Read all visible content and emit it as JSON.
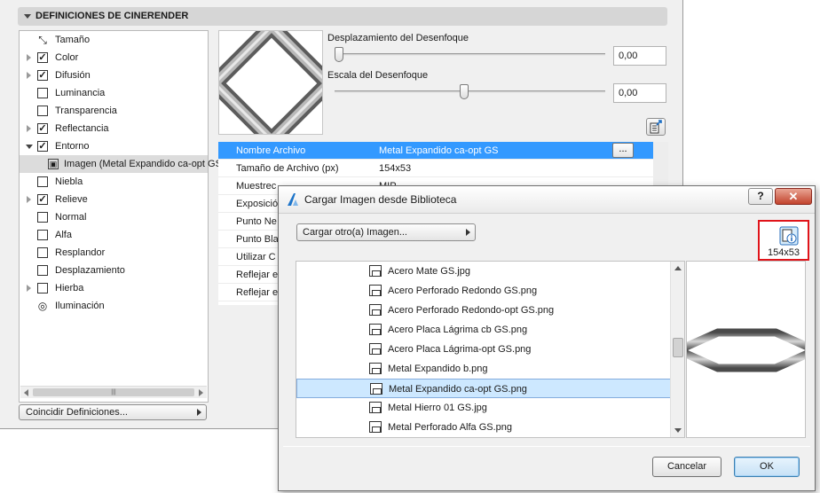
{
  "panel": {
    "header": "DEFINICIONES DE CINERENDER",
    "tree": [
      {
        "label": "Tamaño",
        "checked": null,
        "icon": "size-icon",
        "expander": false
      },
      {
        "label": "Color",
        "checked": true,
        "expander": true
      },
      {
        "label": "Difusión",
        "checked": true,
        "expander": true
      },
      {
        "label": "Luminancia",
        "checked": false,
        "expander": false
      },
      {
        "label": "Transparencia",
        "checked": false,
        "expander": false
      },
      {
        "label": "Reflectancia",
        "checked": true,
        "expander": true
      },
      {
        "label": "Entorno",
        "checked": true,
        "expander": "open"
      },
      {
        "label": "Imagen (Metal Expandido ca-opt GS)",
        "child": true,
        "selected": true,
        "icon": "image-icon"
      },
      {
        "label": "Niebla",
        "checked": false,
        "expander": false
      },
      {
        "label": "Relieve",
        "checked": true,
        "expander": true
      },
      {
        "label": "Normal",
        "checked": false,
        "expander": false
      },
      {
        "label": "Alfa",
        "checked": false,
        "expander": false
      },
      {
        "label": "Resplandor",
        "checked": false,
        "expander": false
      },
      {
        "label": "Desplazamiento",
        "checked": false,
        "expander": false
      },
      {
        "label": "Hierba",
        "checked": false,
        "expander": true
      },
      {
        "label": "Iluminación",
        "checked": null,
        "icon": "lightbulb-icon",
        "expander": false
      }
    ],
    "match_button": "Coincidir Definiciones...",
    "blur_offset": {
      "label": "Desplazamiento del Desenfoque",
      "value": "0,00",
      "level": 0.0
    },
    "blur_scale": {
      "label": "Escala del Desenfoque",
      "value": "0,00",
      "level": 0.48
    },
    "properties": [
      {
        "key": "Nombre Archivo",
        "value": "Metal Expandido ca-opt GS",
        "selected": true,
        "browse": "..."
      },
      {
        "key": "Tamaño de Archivo (px)",
        "value": "154x53"
      },
      {
        "key": "Muestrec",
        "value": "MIP"
      },
      {
        "key": "Exposició",
        "value": ""
      },
      {
        "key": "Punto Ne",
        "value": ""
      },
      {
        "key": "Punto Bla",
        "value": ""
      },
      {
        "key": "Utilizar C",
        "value": ""
      },
      {
        "key": "Reflejar e",
        "value": ""
      },
      {
        "key": "Reflejar e",
        "value": ""
      }
    ]
  },
  "dialog": {
    "title": "Cargar Imagen desde Biblioteca",
    "help": "?",
    "close": "✕",
    "other_button": "Cargar otro(a) Imagen...",
    "info_size": "154x53",
    "files": [
      {
        "name": "Acero Mate GS.jpg"
      },
      {
        "name": "Acero Perforado Redondo GS.png"
      },
      {
        "name": "Acero Perforado Redondo-opt GS.png"
      },
      {
        "name": "Acero Placa Lágrima cb GS.png"
      },
      {
        "name": "Acero Placa Lágrima-opt GS.png"
      },
      {
        "name": "Metal Expandido b.png"
      },
      {
        "name": "Metal Expandido ca-opt GS.png",
        "selected": true
      },
      {
        "name": "Metal Hierro 01 GS.jpg"
      },
      {
        "name": "Metal Perforado Alfa GS.png"
      }
    ],
    "cancel": "Cancelar",
    "ok": "OK"
  },
  "colors": {
    "selection": "#3399ff",
    "list_selection": "#cde8ff",
    "highlight_border": "#e0141a"
  }
}
